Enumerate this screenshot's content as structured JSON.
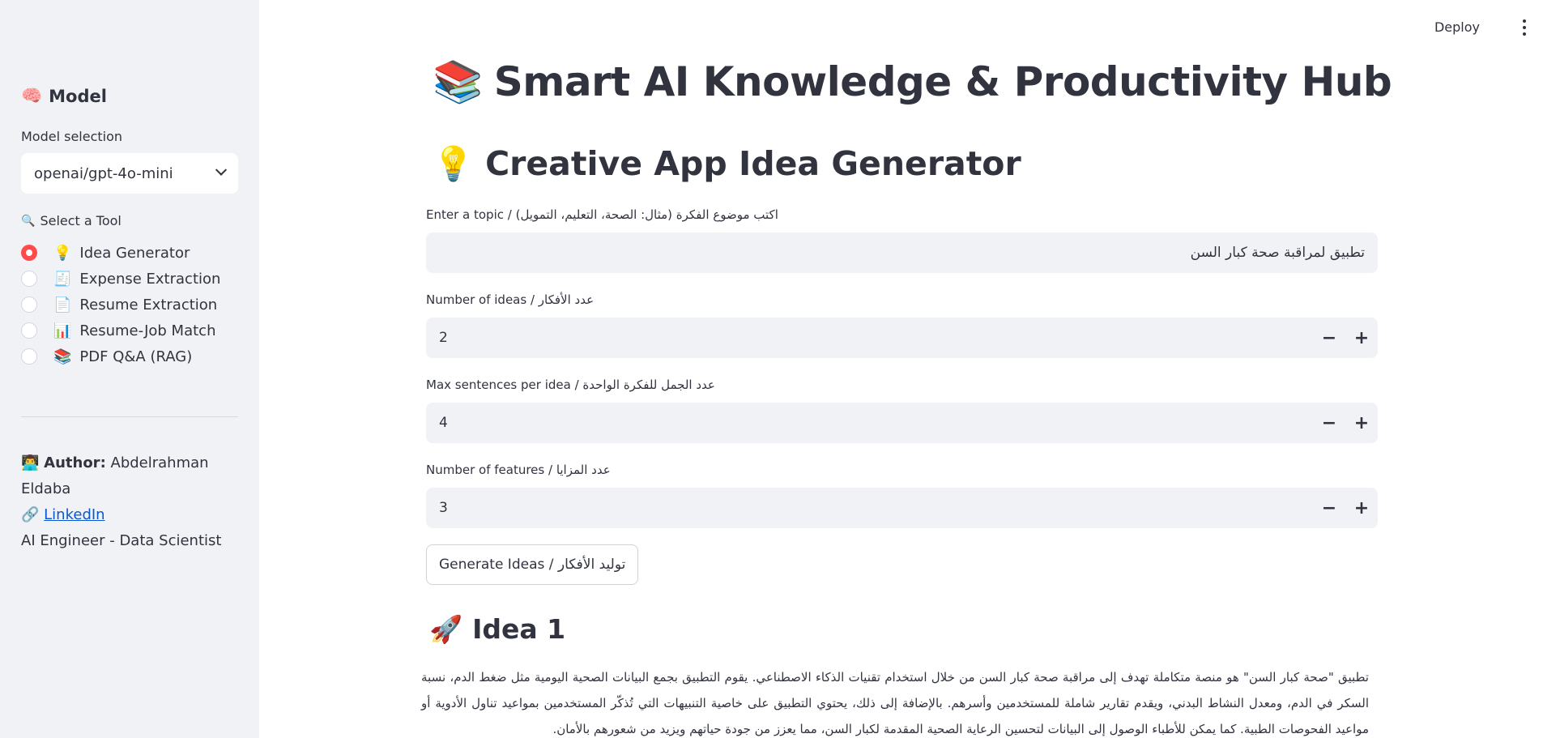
{
  "topbar": {
    "deploy_label": "Deploy"
  },
  "sidebar": {
    "model_header_icon": "🧠",
    "model_header": "Model",
    "model_selection_label": "Model selection",
    "model_selected": "openai/gpt-4o-mini",
    "tool_label_icon": "🔍",
    "tool_label": "Select a Tool",
    "tools": [
      {
        "icon": "💡",
        "label": "Idea Generator",
        "selected": true
      },
      {
        "icon": "🧾",
        "label": "Expense Extraction",
        "selected": false
      },
      {
        "icon": "📄",
        "label": "Resume Extraction",
        "selected": false
      },
      {
        "icon": "📊",
        "label": "Resume-Job Match",
        "selected": false
      },
      {
        "icon": "📚",
        "label": "PDF Q&A (RAG)",
        "selected": false
      }
    ],
    "author_icon": "👨‍💻",
    "author_label": "Author:",
    "author_name": "Abdelrahman Eldaba",
    "linkedin_icon": "🔗",
    "linkedin_label": "LinkedIn",
    "role": "AI Engineer - Data Scientist"
  },
  "main": {
    "title_icon": "📚",
    "title": "Smart AI Knowledge & Productivity Hub",
    "section_icon": "💡",
    "section_title": "Creative App Idea Generator",
    "topic_label": "Enter a topic / (اكتب موضوع الفكرة (مثال: الصحة، التعليم، التمويل",
    "topic_value": "تطبيق لمراقبة صحة كبار السن",
    "num_ideas_label": "Number of ideas / عدد الأفكار",
    "num_ideas_value": "2",
    "max_sentences_label": "Max sentences per idea / عدد الجمل للفكرة الواحدة",
    "max_sentences_value": "4",
    "num_features_label": "Number of features / عدد المزايا",
    "num_features_value": "3",
    "minus": "−",
    "plus": "+",
    "generate_button": "Generate Ideas / توليد الأفكار",
    "idea_icon": "🚀",
    "idea_title": "Idea 1",
    "idea_text": "تطبيق \"صحة كبار السن\" هو منصة متكاملة تهدف إلى مراقبة صحة كبار السن من خلال استخدام تقنيات الذكاء الاصطناعي. يقوم التطبيق بجمع البيانات الصحية اليومية مثل ضغط الدم، نسبة السكر في الدم، ومعدل النشاط البدني، ويقدم تقارير شاملة للمستخدمين وأسرهم. بالإضافة إلى ذلك، يحتوي التطبيق على خاصية التنبيهات التي تُذكّر المستخدمين بمواعيد تناول الأدوية أو مواعيد الفحوصات الطبية. كما يمكن للأطباء الوصول إلى البيانات لتحسين الرعاية الصحية المقدمة لكبار السن، مما يعزز من جودة حياتهم ويزيد من شعورهم بالأمان."
  }
}
